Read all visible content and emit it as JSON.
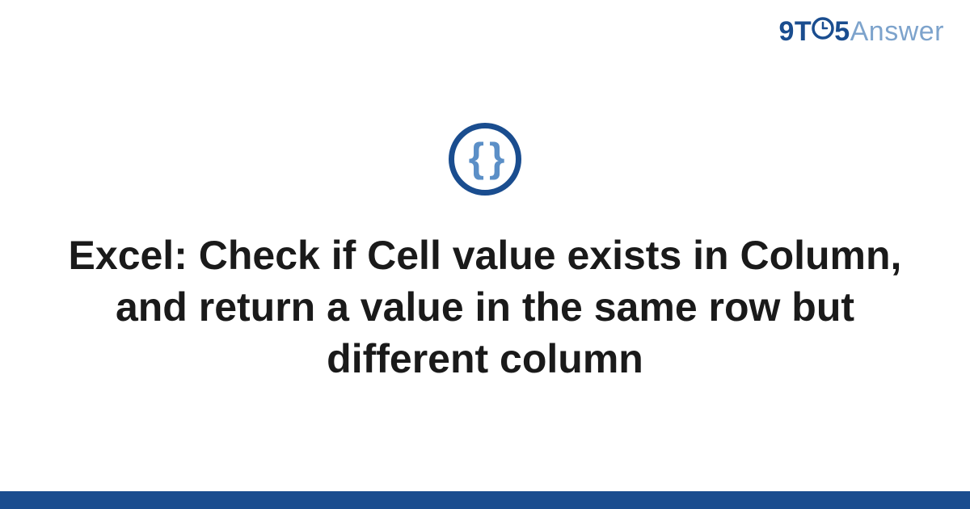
{
  "logo": {
    "part1": "9T",
    "part2": "5",
    "part3": "Answer"
  },
  "icon": {
    "content": "{ }",
    "name": "code-braces-icon"
  },
  "title": "Excel: Check if Cell value exists in Column, and return a value in the same row but different column",
  "colors": {
    "primary": "#1a4d8f",
    "accent": "#5b8fc7",
    "light_accent": "#7da3cc"
  }
}
